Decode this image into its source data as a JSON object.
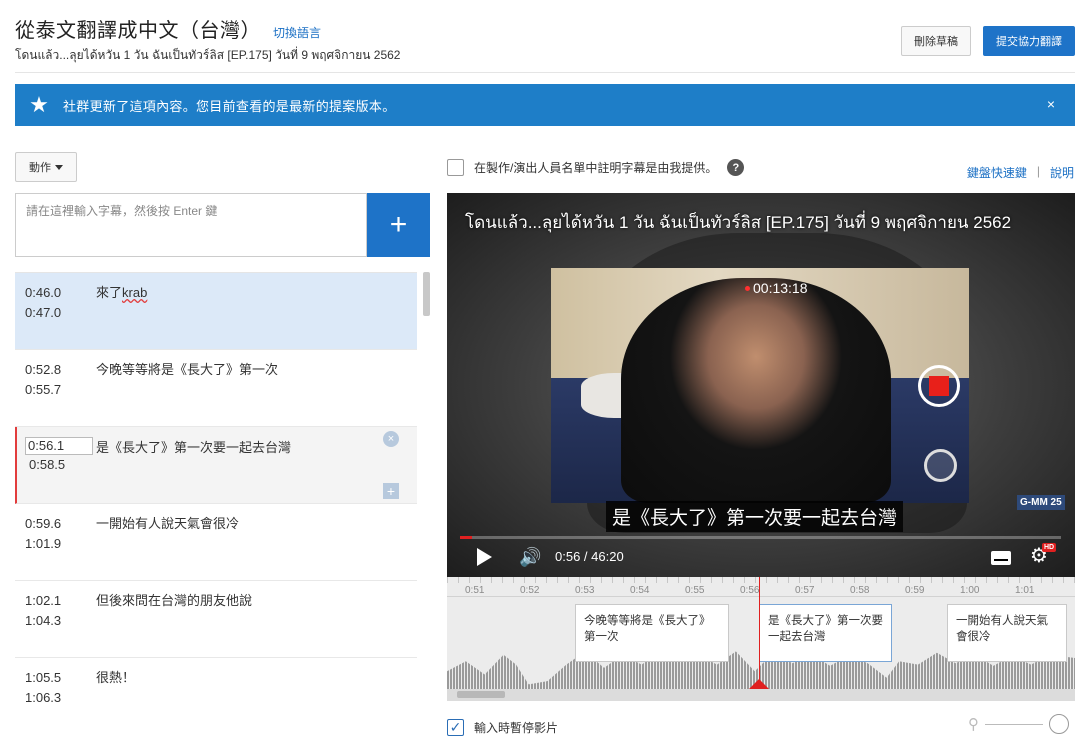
{
  "header": {
    "title": "從泰文翻譯成中文（台灣）",
    "switch_language": "切換語言",
    "subtitle": "โดนแล้ว...ลุยได้หวัน 1 วัน ฉันเป็นทัวร์ลิส [EP.175] วันที่ 9 พฤศจิกายน 2562",
    "discard_button": "刪除草稿",
    "submit_button": "提交協力翻譯"
  },
  "banner": {
    "message": "社群更新了這項內容。您目前查看的是最新的提案版本。",
    "close": "×",
    "icon": "star-icon"
  },
  "editor": {
    "actions_button": "動作",
    "input_placeholder": "請在這裡輸入字幕，然後按 Enter 鍵",
    "add_button": "+"
  },
  "captions": [
    {
      "start": "0:46.0",
      "end": "0:47.0",
      "text": "來了krab",
      "state": "selected"
    },
    {
      "start": "0:52.8",
      "end": "0:55.7",
      "text": "今晚等等將是《長大了》第一次",
      "state": ""
    },
    {
      "start": "0:56.1",
      "end": "0:58.5",
      "text": "是《長大了》第一次要一起去台灣",
      "state": "editing"
    },
    {
      "start": "0:59.6",
      "end": "1:01.9",
      "text": "一開始有人說天氣會很冷",
      "state": ""
    },
    {
      "start": "1:02.1",
      "end": "1:04.3",
      "text": "但後來問在台灣的朋友他說",
      "state": ""
    },
    {
      "start": "1:05.5",
      "end": "1:06.3",
      "text": "很熱！",
      "state": ""
    }
  ],
  "credit": {
    "label": "在製作/演出人員名單中註明字幕是由我提供。",
    "help": "?"
  },
  "links": {
    "shortcuts": "鍵盤快速鍵",
    "separator": "|",
    "help": "說明"
  },
  "player": {
    "title": "โดนแล้ว...ลุยได้หวัน 1 วัน ฉันเป็นทัวร์ลิส [EP.175] วันที่ 9 พฤศจิกายน 2562",
    "recording_time": "00:13:18",
    "caption": "是《長大了》第一次要一起去台灣",
    "current_time": "0:56 / 46:20",
    "progress": 0.02,
    "logo": "G-MM 25",
    "hd_badge": "HD"
  },
  "timeline": {
    "ticks": [
      "0:51",
      "0:52",
      "0:53",
      "0:54",
      "0:55",
      "0:56",
      "0:57",
      "0:58",
      "0:59",
      "1:00",
      "1:01"
    ],
    "captions": [
      {
        "text": "今晚等等將是《長大了》第一次",
        "active": false
      },
      {
        "text": "是《長大了》第一次要一起去台灣",
        "active": true
      },
      {
        "text": "一開始有人說天氣會很冷",
        "active": false
      }
    ]
  },
  "footer": {
    "pause_while_typing": "輸入時暫停影片",
    "pause_checked": true,
    "checkmark": "✓"
  },
  "colors": {
    "accent": "#1e73c8",
    "banner": "#1e7ec8",
    "playhead": "#e02020"
  }
}
